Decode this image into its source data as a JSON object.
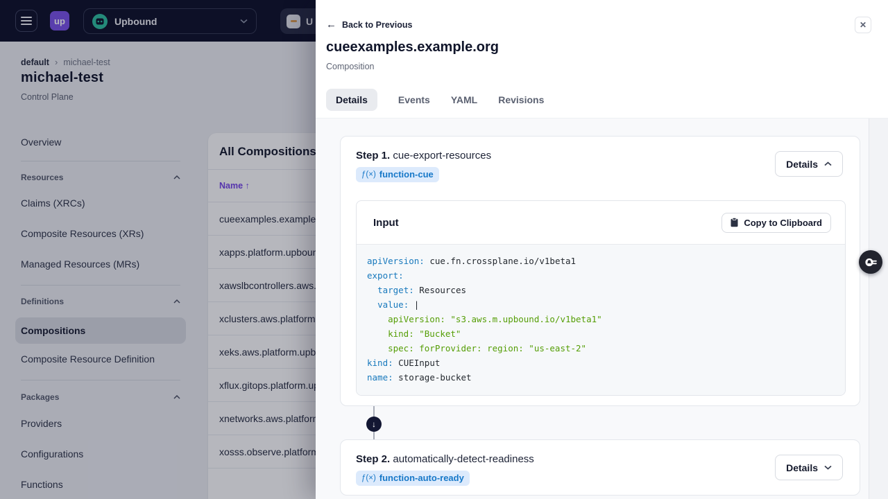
{
  "colors": {
    "topbar_bg": "#0d1129",
    "logo_purple": "#7a52e8",
    "mascot_teal": "#2fbfa0",
    "table_sort_purple": "#7646e8",
    "badge_bg": "#dceafc",
    "badge_text": "#1778c8",
    "code_key": "#1879bd",
    "code_string": "#559e06",
    "code_text": "#24292f",
    "connector_navy": "#131733"
  },
  "icons": {
    "close_glyph": "✕",
    "back_arrow": "←",
    "breadcrumb_separator": "›",
    "connector_arrow": "↓",
    "fx_glyph": "ƒ(×)"
  },
  "topbar": {
    "logo_text": "up",
    "org_name": "Upbound",
    "account_partial": "U"
  },
  "page": {
    "breadcrumb": {
      "root": "default",
      "current": "michael-test"
    },
    "title": "michael-test",
    "subtitle": "Control Plane",
    "sidebar": {
      "top_item": "Overview",
      "sections": [
        {
          "header": "Resources",
          "items": [
            "Claims (XRCs)",
            "Composite Resources (XRs)",
            "Managed Resources (MRs)"
          ]
        },
        {
          "header": "Definitions",
          "items": [
            "Compositions",
            "Composite Resource Definition"
          ],
          "active_item": "Compositions"
        },
        {
          "header": "Packages",
          "items": [
            "Providers",
            "Configurations",
            "Functions"
          ]
        }
      ]
    },
    "table": {
      "title": "All Compositions",
      "sort_column": "Name",
      "sort_indicator": "↑",
      "rows": [
        "cueexamples.example.or",
        "xapps.platform.upboun",
        "xawslbcontrollers.aws.",
        "xclusters.aws.platform.",
        "xeks.aws.platform.upbo",
        "xflux.gitops.platform.up",
        "xnetworks.aws.platform",
        "xosss.observe.platform"
      ]
    }
  },
  "panel": {
    "back_label": "Back to Previous",
    "title": "cueexamples.example.org",
    "subtitle": "Composition",
    "tabs": [
      "Details",
      "Events",
      "YAML",
      "Revisions"
    ],
    "active_tab": "Details",
    "steps": [
      {
        "label": "Step 1.",
        "name": "cue-export-resources",
        "function_badge": "function-cue",
        "details_button": "Details",
        "state": "expanded",
        "input_section": {
          "heading": "Input",
          "copy_button": "Copy to Clipboard",
          "code_lines": [
            [
              {
                "t": "key",
                "v": "apiVersion:"
              },
              {
                "t": "plain",
                "v": " cue.fn.crossplane.io/v1beta1"
              }
            ],
            [
              {
                "t": "key",
                "v": "export:"
              }
            ],
            [
              {
                "t": "plain",
                "v": "  "
              },
              {
                "t": "key",
                "v": "target:"
              },
              {
                "t": "plain",
                "v": " Resources"
              }
            ],
            [
              {
                "t": "plain",
                "v": "  "
              },
              {
                "t": "key",
                "v": "value:"
              },
              {
                "t": "plain",
                "v": " |"
              }
            ],
            [
              {
                "t": "str",
                "v": "    apiVersion: \"s3.aws.m.upbound.io/v1beta1\""
              }
            ],
            [
              {
                "t": "str",
                "v": "    kind: \"Bucket\""
              }
            ],
            [
              {
                "t": "str",
                "v": "    spec: forProvider: region: \"us-east-2\""
              }
            ],
            [
              {
                "t": "key",
                "v": "kind:"
              },
              {
                "t": "plain",
                "v": " CUEInput"
              }
            ],
            [
              {
                "t": "key",
                "v": "name:"
              },
              {
                "t": "plain",
                "v": " storage-bucket"
              }
            ]
          ]
        }
      },
      {
        "label": "Step 2.",
        "name": "automatically-detect-readiness",
        "function_badge": "function-auto-ready",
        "details_button": "Details",
        "state": "collapsed"
      }
    ]
  }
}
